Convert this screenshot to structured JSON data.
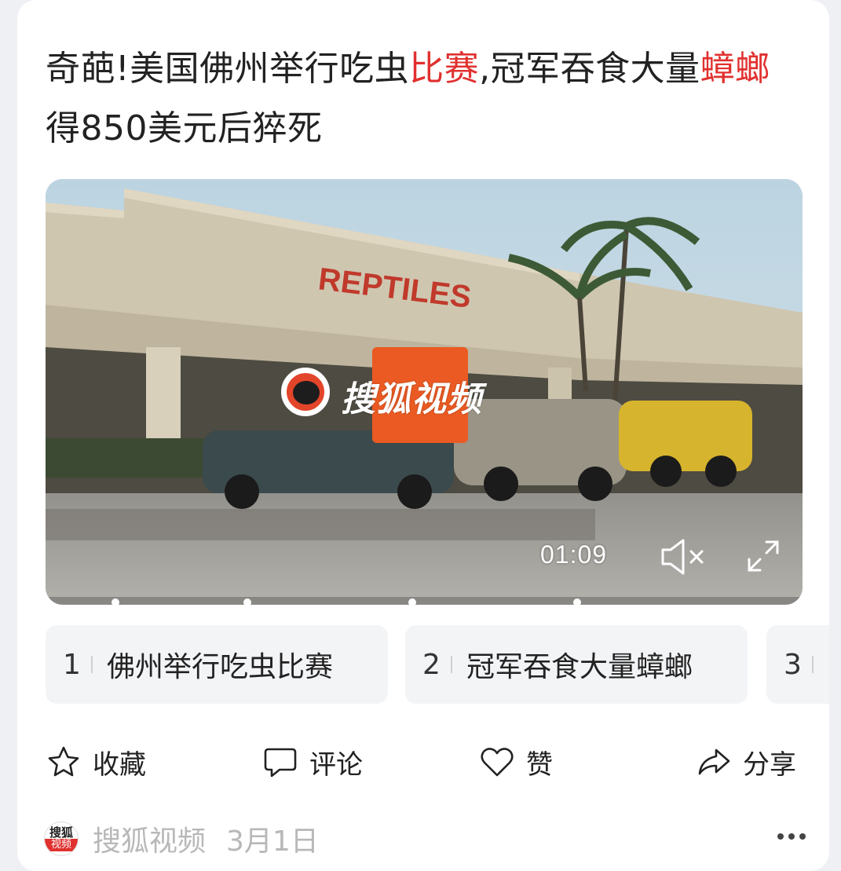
{
  "article": {
    "title_parts": [
      {
        "text": "奇葩!美国佛州举行吃虫",
        "highlight": false
      },
      {
        "text": "比赛",
        "highlight": true
      },
      {
        "text": ",冠军吞食大量",
        "highlight": false
      },
      {
        "text": "蟑螂",
        "highlight": true
      },
      {
        "text": "得850美元后猝死",
        "highlight": false
      }
    ],
    "highlight_color": "#e0312f"
  },
  "video": {
    "sign_text": "REPTILES",
    "watermark_text": "搜狐视频",
    "duration": "01:09",
    "muted": true,
    "chapter_marker_count": 4
  },
  "chapters": [
    {
      "num": "1",
      "label": "佛州举行吃虫比赛"
    },
    {
      "num": "2",
      "label": "冠军吞食大量蟑螂"
    },
    {
      "num": "3",
      "label": ""
    }
  ],
  "actions": {
    "favorite": "收藏",
    "comment": "评论",
    "like": "赞",
    "share": "分享"
  },
  "source": {
    "logo_line1": "搜狐",
    "logo_line2": "视频",
    "name": "搜狐视频",
    "date": "3月1日"
  }
}
